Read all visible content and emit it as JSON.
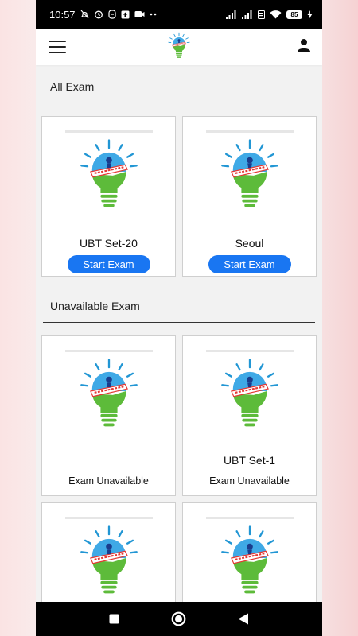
{
  "status_bar": {
    "time": "10:57",
    "battery": "85",
    "left_icons": [
      "mute-icon",
      "alarm-icon",
      "data-saver-icon",
      "upload-icon",
      "camera-icon",
      "more-dots-icon"
    ],
    "right_icons": [
      "signal-icon",
      "signal-icon",
      "volte-icon",
      "wifi-icon",
      "battery-icon",
      "charging-icon"
    ]
  },
  "app_bar": {
    "menu_icon": "hamburger-menu-icon",
    "logo_icon": "lightbulb-logo-icon",
    "profile_icon": "person-icon"
  },
  "sections": {
    "all_exam": {
      "title": "All Exam",
      "cards": [
        {
          "title": "UBT Set-20",
          "button": "Start Exam"
        },
        {
          "title": "Seoul",
          "button": "Start Exam"
        }
      ]
    },
    "unavailable_exam": {
      "title": "Unavailable Exam",
      "cards": [
        {
          "title": "",
          "status": "Exam Unavailable"
        },
        {
          "title": "UBT Set-1",
          "status": "Exam Unavailable"
        },
        {
          "title": "",
          "status": ""
        },
        {
          "title": "",
          "status": ""
        }
      ]
    }
  },
  "nav_bar": {
    "recents_icon": "square-recents-icon",
    "home_icon": "circle-home-icon",
    "back_icon": "triangle-back-icon"
  },
  "colors": {
    "accent": "#1976f2",
    "bulb_green": "#5dbb3a",
    "bulb_blue": "#3fa9e6",
    "ray_blue": "#2196d4"
  }
}
